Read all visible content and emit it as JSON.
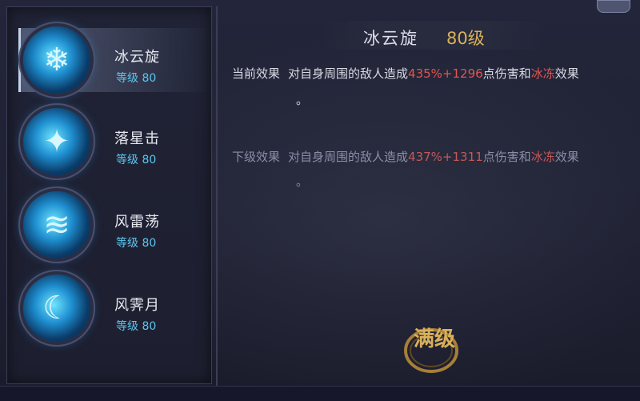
{
  "skills": [
    {
      "name": "冰云旋",
      "level": "等级 80",
      "icon": "ice-swirl-icon",
      "selected": true
    },
    {
      "name": "落星击",
      "level": "等级 80",
      "icon": "star-strike-icon",
      "selected": false
    },
    {
      "name": "风雷荡",
      "level": "等级 80",
      "icon": "wind-thunder-icon",
      "selected": false
    },
    {
      "name": "风霁月",
      "level": "等级 80",
      "icon": "wind-moon-icon",
      "selected": false
    }
  ],
  "detail": {
    "name": "冰云旋",
    "level": "80级",
    "current": {
      "label": "当前效果",
      "text_a": "对自身周围的敌人造成",
      "damage": "435%+1296",
      "text_b": "点伤害和",
      "status": "冰冻",
      "text_c": "效果",
      "end": "。"
    },
    "next": {
      "label": "下级效果",
      "text_a": "对自身周围的敌人造成",
      "damage": "437%+1311",
      "text_b": "点伤害和",
      "status": "冰冻",
      "text_c": "效果",
      "end": "。"
    }
  },
  "badge": {
    "text": "满级"
  },
  "colors": {
    "highlight": "#e0564f",
    "level_gold": "#d9b05a",
    "level_blue": "#5cc6ef"
  }
}
